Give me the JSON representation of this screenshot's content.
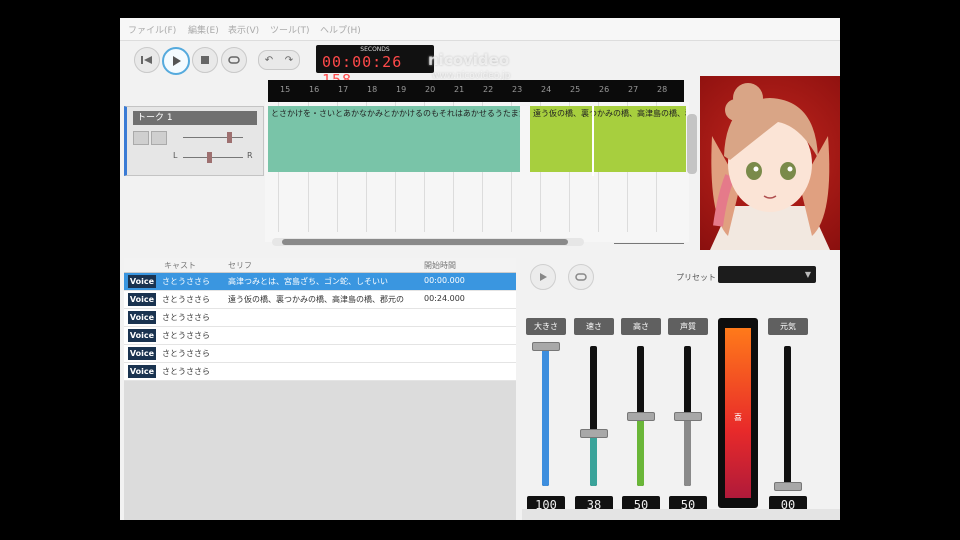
{
  "menu": {
    "items": [
      "ファイル(F)",
      "編集(E)",
      "表示(V)",
      "ツール(T)",
      "ヘルプ(H)"
    ]
  },
  "toolbar": {
    "buttons": [
      "rewind-icon",
      "play-icon",
      "stop-icon",
      "loop-icon",
      "undo-icon",
      "redo-icon"
    ],
    "counter_label": "SECONDS",
    "counter_time": "00:00:26",
    "counter_frac": "158"
  },
  "watermark": {
    "line1": "nicovideo",
    "line2": "www.nicovideo.jp"
  },
  "ruler": {
    "ticks": [
      "15",
      "16",
      "17",
      "18",
      "19",
      "20",
      "21",
      "22",
      "23",
      "24",
      "25",
      "26",
      "27",
      "28"
    ]
  },
  "track": {
    "name": "トーク 1",
    "left_label": "L",
    "right_label": "R"
  },
  "timeline": {
    "segments": [
      {
        "text": "とさかけを・さいとあかなかみとかかけるのもそれはあかせるうたまたさつましかいのだ",
        "color": "#79c4a8"
      },
      {
        "text": "遠う仮の橋、裏つかみの橋、高津島の橋、郡元の橋",
        "color": "#a7cf3e"
      }
    ]
  },
  "table": {
    "headers": {
      "cast": "キャスト",
      "serif": "セリフ",
      "start": "開始時間"
    },
    "voice_label": "Voice",
    "rows": [
      {
        "cast": "さとうささら",
        "serif": "高津つみとは、宮島ざち、ゴン蛇、しそいい",
        "start": "00:00.000",
        "selected": true
      },
      {
        "cast": "さとうささら",
        "serif": "遠う仮の橋、裏つかみの橋、高津島の橋、郡元の",
        "start": "00:24.000",
        "selected": false
      },
      {
        "cast": "さとうささら",
        "serif": "",
        "start": "",
        "selected": false
      },
      {
        "cast": "さとうささら",
        "serif": "",
        "start": "",
        "selected": false
      },
      {
        "cast": "さとうささら",
        "serif": "",
        "start": "",
        "selected": false
      },
      {
        "cast": "さとうささら",
        "serif": "",
        "start": "",
        "selected": false
      }
    ]
  },
  "params": {
    "preset_label": "プリセット",
    "preset_value": "",
    "sliders": [
      {
        "label": "大きさ",
        "value": "100",
        "level": 1.0,
        "color": "#3d8ede"
      },
      {
        "label": "速さ",
        "value": "38",
        "level": 0.38,
        "color": "#3aa39a"
      },
      {
        "label": "高さ",
        "value": "50",
        "level": 0.5,
        "color": "#6ab638"
      },
      {
        "label": "声質",
        "value": "50",
        "level": 0.5,
        "color": "#8a8a8a"
      },
      {
        "label": "元気",
        "value": "00",
        "level": 0.0,
        "color": "#8a8a8a"
      }
    ],
    "meter_label": "喜"
  }
}
